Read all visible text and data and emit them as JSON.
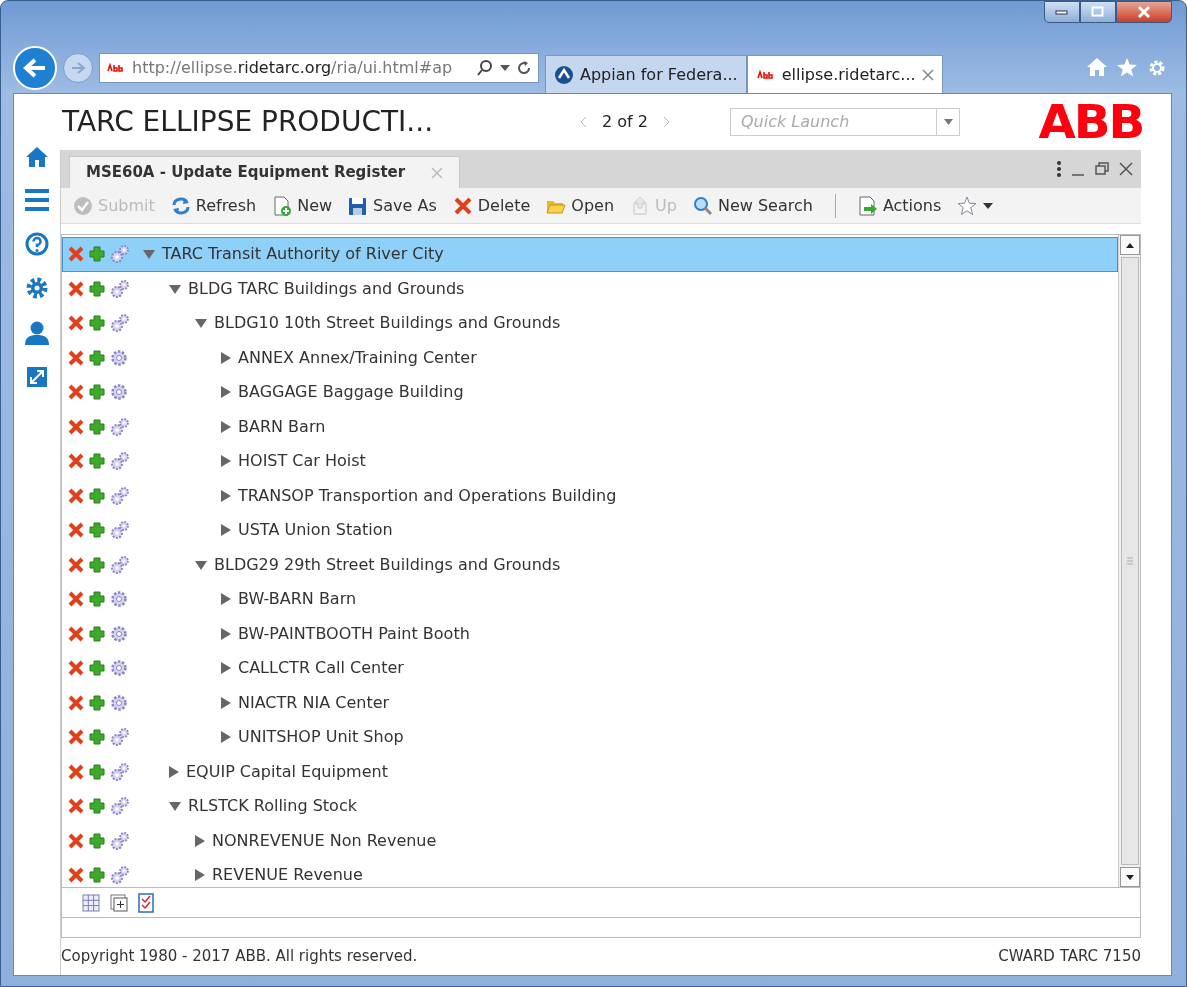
{
  "browser": {
    "address": "http://ellipse.**ridetarc.org**/ria/ui.html#ap",
    "tabs": [
      {
        "label": "Appian for Federa...",
        "selected": false
      },
      {
        "label": "ellipse.ridetarc...",
        "selected": true
      }
    ]
  },
  "app": {
    "title": "TARC ELLIPSE PRODUCTI...",
    "pager": "2 of 2",
    "quick_launch": {
      "placeholder": "Quick Launch"
    },
    "logo": "ABB"
  },
  "panel": {
    "title": "MSE60A - Update Equipment Register",
    "toolbar": [
      {
        "kind": "submit",
        "label": "Submit",
        "disabled": true
      },
      {
        "kind": "refresh",
        "label": "Refresh",
        "disabled": false
      },
      {
        "kind": "new",
        "label": "New",
        "disabled": false
      },
      {
        "kind": "save",
        "label": "Save As",
        "disabled": false
      },
      {
        "kind": "delete",
        "label": "Delete",
        "disabled": false
      },
      {
        "kind": "open",
        "label": "Open",
        "disabled": false
      },
      {
        "kind": "up",
        "label": "Up",
        "disabled": true
      },
      {
        "kind": "search",
        "label": "New Search",
        "disabled": false
      },
      {
        "kind": "actions",
        "label": "Actions",
        "disabled": false
      }
    ],
    "tree": [
      {
        "label": "TARC Transit Authority of River City",
        "kind": "double",
        "expanded": true,
        "selected": true,
        "children": [
          {
            "label": "BLDG TARC Buildings and Grounds",
            "kind": "double",
            "expanded": true,
            "selected": false,
            "children": [
              {
                "label": "BLDG10 10th Street Buildings and Grounds",
                "kind": "double",
                "expanded": true,
                "selected": false,
                "children": [
                  {
                    "label": "ANNEX Annex/Training Center",
                    "kind": "single",
                    "expanded": false,
                    "selected": false
                  },
                  {
                    "label": "BAGGAGE Baggage Building",
                    "kind": "single",
                    "expanded": false,
                    "selected": false
                  },
                  {
                    "label": "BARN Barn",
                    "kind": "double",
                    "expanded": false,
                    "selected": false
                  },
                  {
                    "label": "HOIST Car Hoist",
                    "kind": "double",
                    "expanded": false,
                    "selected": false
                  },
                  {
                    "label": "TRANSOP Transportion and Operations Building",
                    "kind": "double",
                    "expanded": false,
                    "selected": false
                  },
                  {
                    "label": "USTA Union Station",
                    "kind": "double",
                    "expanded": false,
                    "selected": false
                  }
                ]
              },
              {
                "label": "BLDG29 29th Street Buildings and Grounds",
                "kind": "double",
                "expanded": true,
                "selected": false,
                "children": [
                  {
                    "label": "BW-BARN Barn",
                    "kind": "single",
                    "expanded": false,
                    "selected": false
                  },
                  {
                    "label": "BW-PAINTBOOTH Paint Booth",
                    "kind": "single",
                    "expanded": false,
                    "selected": false
                  },
                  {
                    "label": "CALLCTR Call Center",
                    "kind": "single",
                    "expanded": false,
                    "selected": false
                  },
                  {
                    "label": "NIACTR NIA Center",
                    "kind": "single",
                    "expanded": false,
                    "selected": false
                  },
                  {
                    "label": "UNITSHOP Unit Shop",
                    "kind": "double",
                    "expanded": false,
                    "selected": false
                  }
                ]
              }
            ]
          },
          {
            "label": "EQUIP Capital Equipment",
            "kind": "double",
            "expanded": false,
            "selected": false
          },
          {
            "label": "RLSTCK Rolling Stock",
            "kind": "double",
            "expanded": true,
            "selected": false,
            "children": [
              {
                "label": "NONREVENUE Non Revenue",
                "kind": "double",
                "expanded": false,
                "selected": false
              },
              {
                "label": "REVENUE Revenue",
                "kind": "double",
                "expanded": false,
                "selected": false
              }
            ]
          }
        ]
      }
    ]
  },
  "footer": {
    "copyright": "Copyright 1980 - 2017 ABB. All rights reserved.",
    "user": "CWARD TARC 7150"
  }
}
